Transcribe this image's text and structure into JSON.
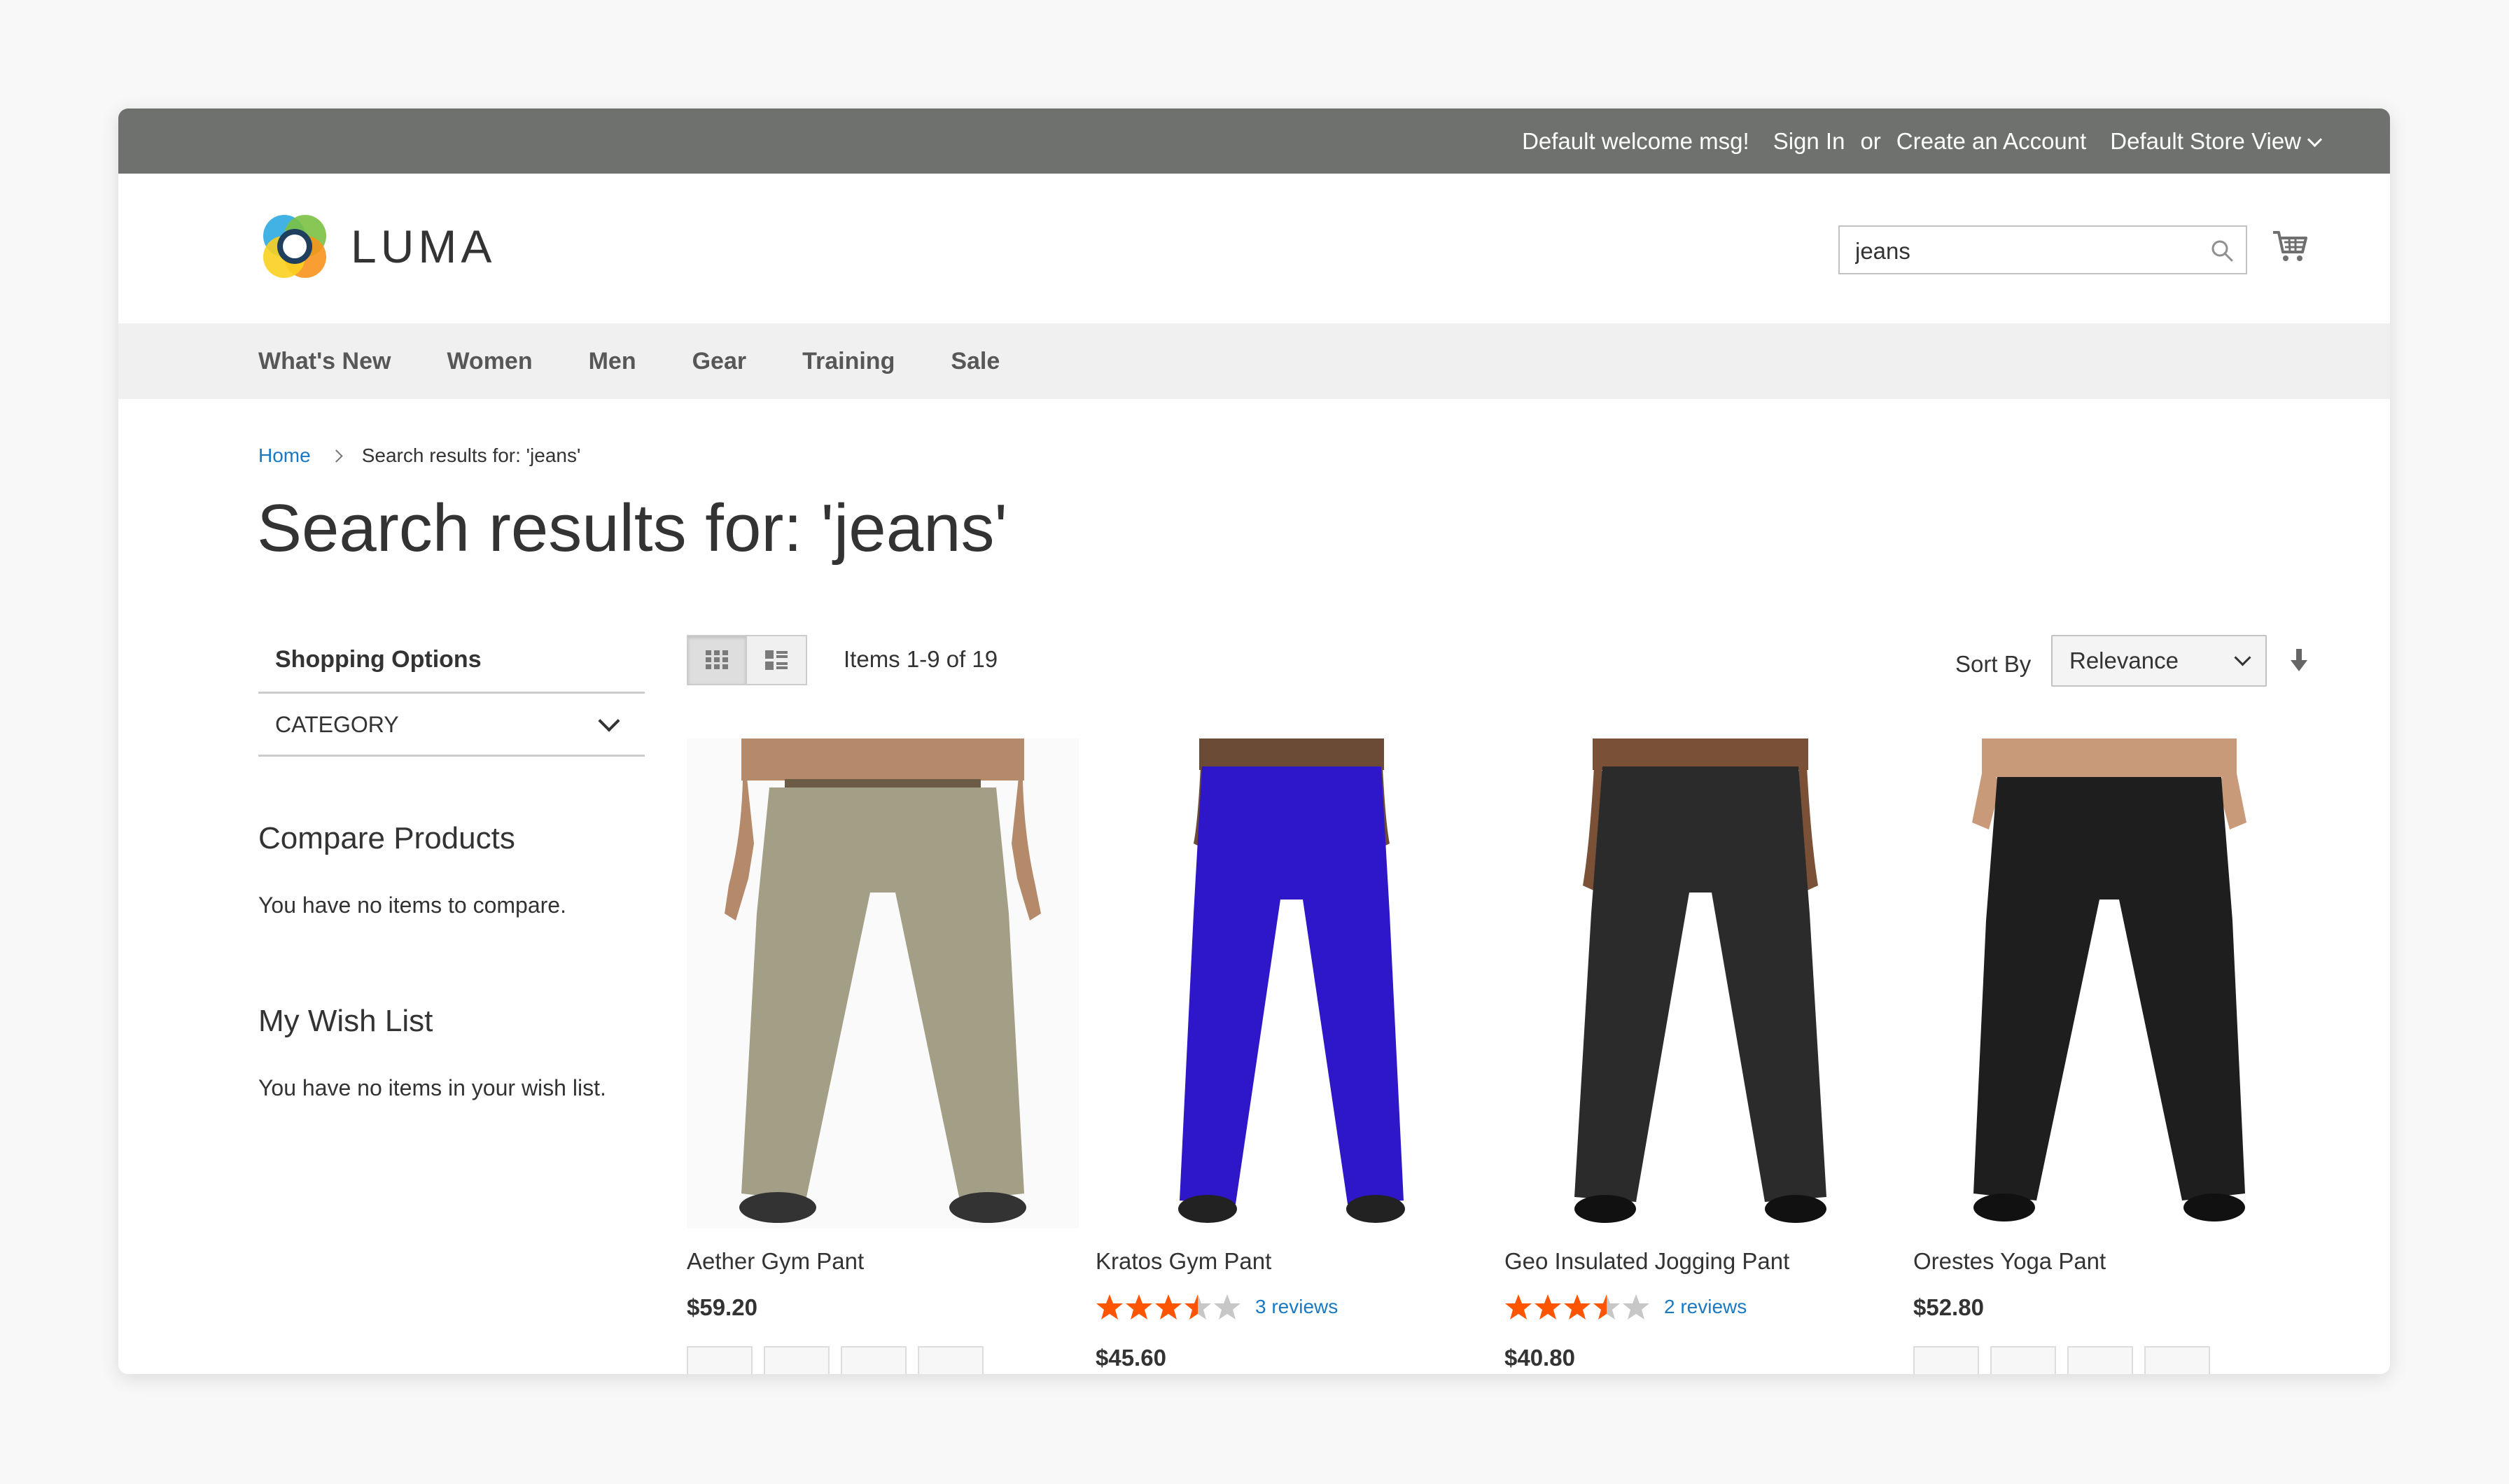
{
  "topbar": {
    "welcome": "Default welcome msg!",
    "sign_in": "Sign In",
    "or": "or",
    "create_account": "Create an Account",
    "store_view": "Default Store View"
  },
  "header": {
    "logo_text": "LUMA",
    "search": {
      "value": "jeans",
      "placeholder": ""
    }
  },
  "nav": {
    "items": [
      "What's New",
      "Women",
      "Men",
      "Gear",
      "Training",
      "Sale"
    ]
  },
  "breadcrumb": {
    "home": "Home",
    "current": "Search results for: 'jeans'"
  },
  "page_title": "Search results for: 'jeans'",
  "sidebar": {
    "shopping_options": "Shopping Options",
    "category": "CATEGORY",
    "compare_title": "Compare Products",
    "compare_text": "You have no items to compare.",
    "wishlist_title": "My Wish List",
    "wishlist_text": "You have no items in your wish list."
  },
  "toolbar": {
    "amount": "Items 1-9 of 19",
    "sort_label": "Sort By",
    "sort_value": "Relevance"
  },
  "products": [
    {
      "name": "Aether Gym Pant",
      "price": "$59.20",
      "color": "#a39f86",
      "rating": null,
      "reviews": ""
    },
    {
      "name": "Kratos Gym Pant",
      "price": "$45.60",
      "color": "#2d17c9",
      "rating": 3.5,
      "reviews": "3 reviews"
    },
    {
      "name": "Geo Insulated Jogging Pant",
      "price": "$40.80",
      "color": "#2b2b2b",
      "rating": 3.5,
      "reviews": "2 reviews"
    },
    {
      "name": "Orestes Yoga Pant",
      "price": "$52.80",
      "color": "#1e1e1e",
      "rating": null,
      "reviews": ""
    }
  ],
  "colors": {
    "topbar_bg": "#6e716e",
    "nav_bg": "#f0f0f0",
    "link": "#1979c3",
    "star": "#ff5501"
  }
}
